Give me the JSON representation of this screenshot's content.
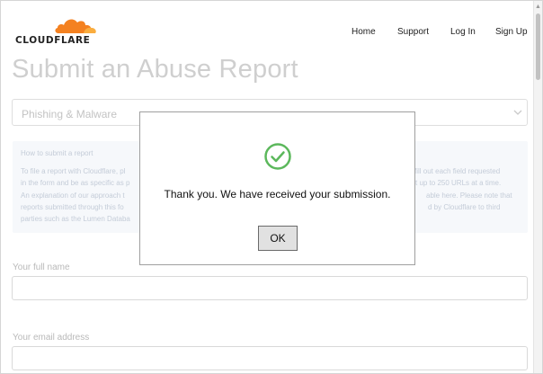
{
  "brand": {
    "name": "CLOUDFLARE",
    "logo_icon": "cloud-icon",
    "colors": {
      "orange": "#f48120",
      "light_orange": "#faad3f"
    }
  },
  "nav": {
    "home": "Home",
    "support": "Support",
    "login": "Log In",
    "signup": "Sign Up"
  },
  "page": {
    "title": "Submit an Abuse Report",
    "report_type": {
      "selected": "Phishing & Malware"
    },
    "info": {
      "heading": "How to submit a report",
      "lines_left": [
        "To file a report with Cloudflare, pl",
        "in the form and be as specific as p",
        "An explanation of our approach t",
        "reports submitted through this fo",
        "parties such as the Lumen Databa"
      ],
      "lines_right": [
        "fill out each field requested",
        "t up to 250 URLs at a time.",
        "able here. Please note that",
        "d by Cloudflare to third"
      ]
    },
    "form": {
      "full_name_label": "Your full name",
      "full_name_value": "",
      "email_label": "Your email address",
      "email_value": ""
    }
  },
  "dialog": {
    "message": "Thank you. We have received your submission.",
    "ok_label": "OK",
    "icon": "success-check-icon",
    "icon_color": "#5cb85c"
  }
}
